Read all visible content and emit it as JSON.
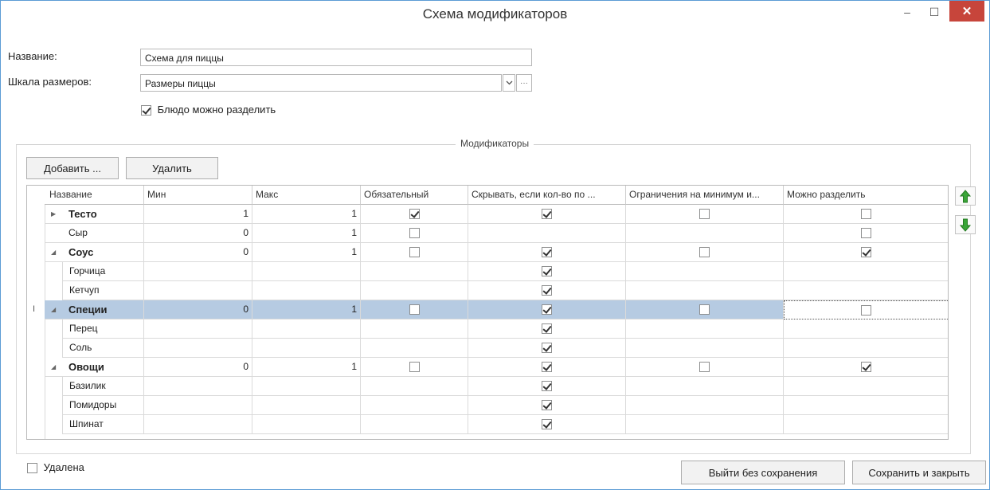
{
  "window": {
    "title": "Схема модификаторов",
    "minimize_glyph": "–",
    "maximize_glyph": "☐",
    "close_glyph": "✕"
  },
  "form": {
    "name_label": "Название:",
    "name_value": "Схема для пиццы",
    "scale_label": "Шкала размеров:",
    "scale_value": "Размеры пиццы",
    "scale_more": "···",
    "divisible_label": "Блюдо можно разделить",
    "divisible_checked": true
  },
  "modifiers": {
    "group_title": "Модификаторы",
    "add_label": "Добавить ...",
    "delete_label": "Удалить",
    "columns": [
      "Название",
      "Мин",
      "Макс",
      "Обязательный",
      "Скрывать, если кол-во по ...",
      "Ограничения на минимум и...",
      "Можно разделить"
    ],
    "rows": [
      {
        "name": "Тесто",
        "group": true,
        "expander": "collapsed",
        "min": "1",
        "max": "1",
        "required": true,
        "hide": true,
        "limits": false,
        "divisible": false
      },
      {
        "name": "Сыр",
        "group": false,
        "expander": "",
        "min": "0",
        "max": "1",
        "required": false,
        "hide": null,
        "limits": null,
        "divisible": false
      },
      {
        "name": "Соус",
        "group": true,
        "expander": "expanded",
        "min": "0",
        "max": "1",
        "required": false,
        "hide": true,
        "limits": false,
        "divisible": true
      },
      {
        "name": "Горчица",
        "group": false,
        "child": true,
        "min": "",
        "max": "",
        "required": null,
        "hide": true,
        "limits": null,
        "divisible": null
      },
      {
        "name": "Кетчуп",
        "group": false,
        "child": true,
        "min": "",
        "max": "",
        "required": null,
        "hide": true,
        "limits": null,
        "divisible": null
      },
      {
        "name": "Специи",
        "group": true,
        "expander": "expanded",
        "selected": true,
        "min": "0",
        "max": "1",
        "required": false,
        "hide": true,
        "limits": false,
        "divisible": false
      },
      {
        "name": "Перец",
        "group": false,
        "child": true,
        "min": "",
        "max": "",
        "required": null,
        "hide": true,
        "limits": null,
        "divisible": null
      },
      {
        "name": "Соль",
        "group": false,
        "child": true,
        "min": "",
        "max": "",
        "required": null,
        "hide": true,
        "limits": null,
        "divisible": null
      },
      {
        "name": "Овощи",
        "group": true,
        "expander": "expanded",
        "min": "0",
        "max": "1",
        "required": false,
        "hide": true,
        "limits": false,
        "divisible": true
      },
      {
        "name": "Базилик",
        "group": false,
        "child": true,
        "min": "",
        "max": "",
        "required": null,
        "hide": true,
        "limits": null,
        "divisible": null
      },
      {
        "name": "Помидоры",
        "group": false,
        "child": true,
        "min": "",
        "max": "",
        "required": null,
        "hide": true,
        "limits": null,
        "divisible": null
      },
      {
        "name": "Шпинат",
        "group": false,
        "child": true,
        "min": "",
        "max": "",
        "required": null,
        "hide": true,
        "limits": null,
        "divisible": null
      }
    ]
  },
  "footer": {
    "deleted_label": "Удалена",
    "deleted_checked": false,
    "exit_label": "Выйти без сохранения",
    "save_label": "Сохранить и закрыть"
  },
  "colors": {
    "selected_row": "#b6cbe2",
    "close_button": "#c7453b",
    "arrow_green": "#3aa538"
  }
}
